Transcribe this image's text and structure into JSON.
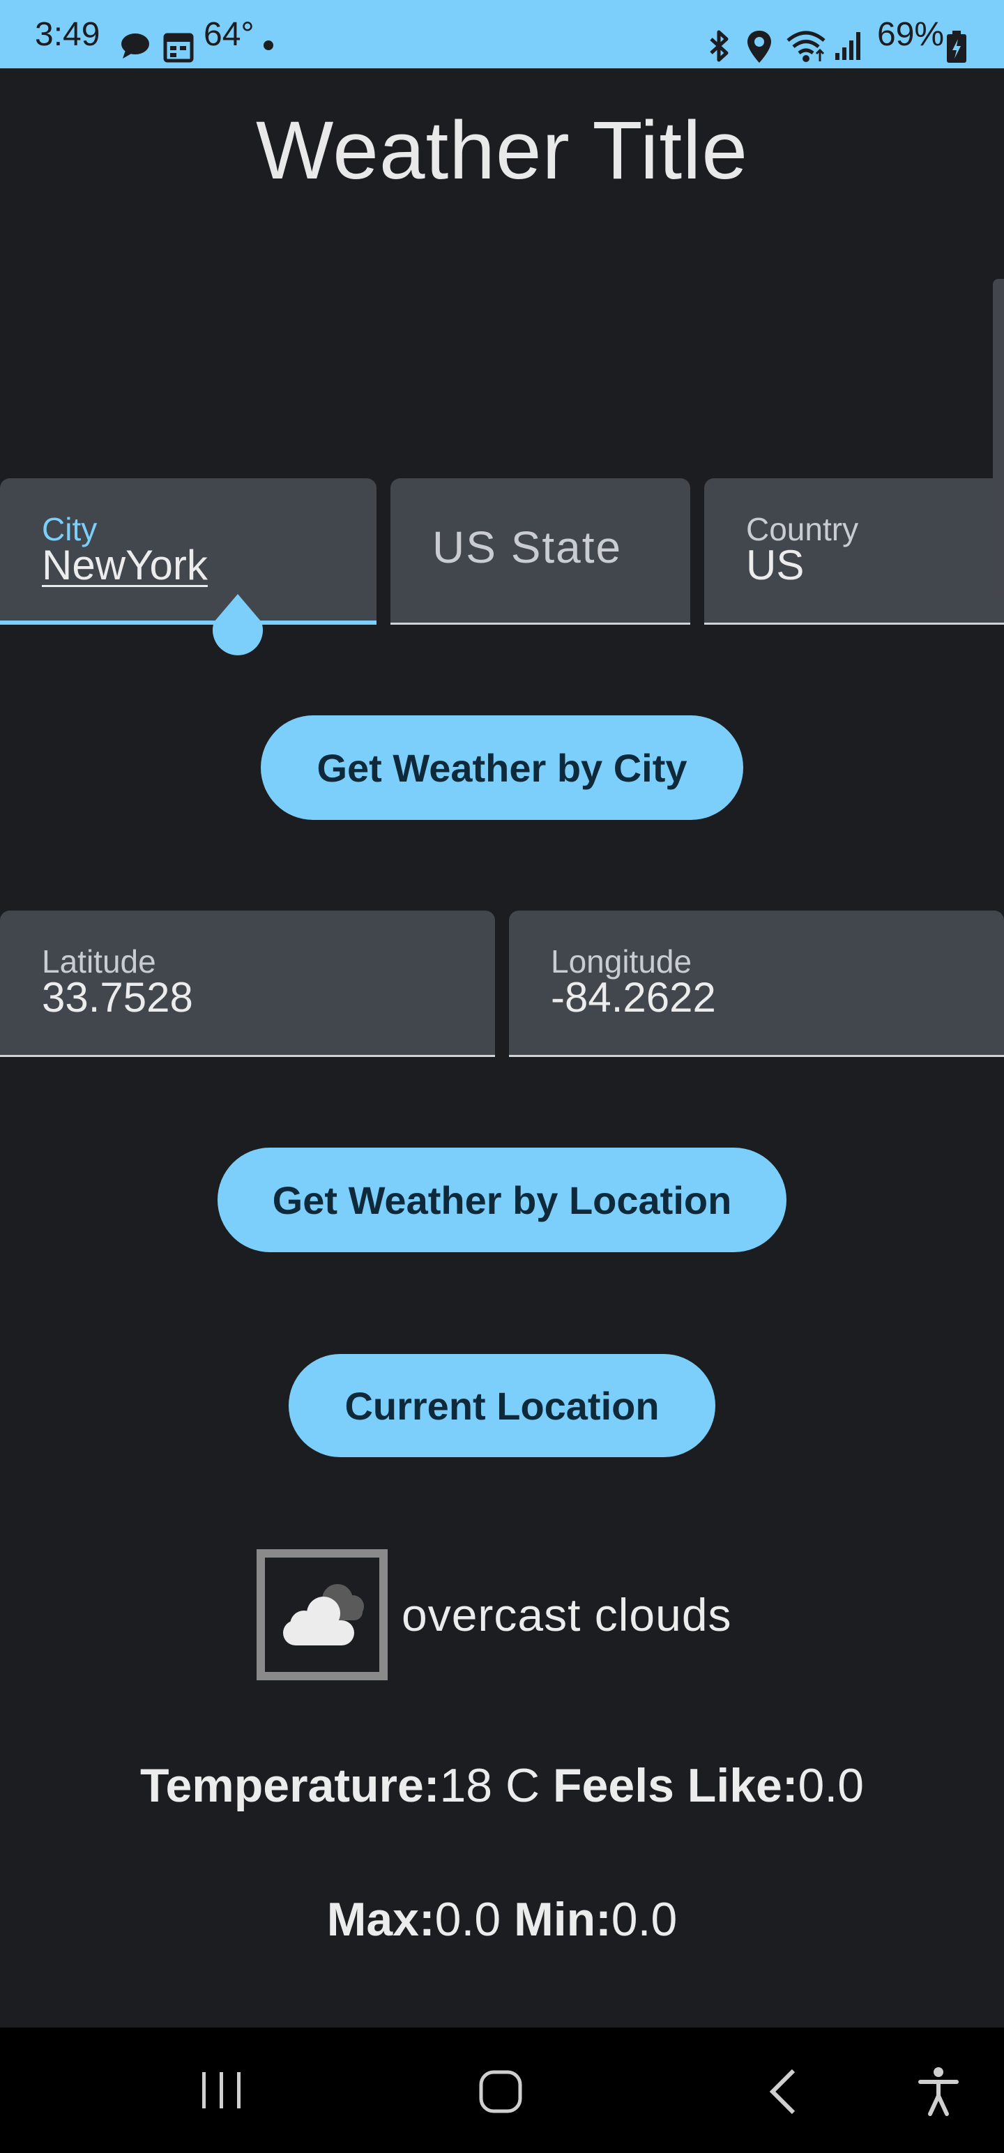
{
  "status_bar": {
    "time": "3:49",
    "temperature": "64°",
    "battery": "69%",
    "icons": [
      "chat-bubble-icon",
      "calendar-icon",
      "dot-icon",
      "bluetooth-icon",
      "location-pin-icon",
      "wifi-icon",
      "signal-icon",
      "battery-charging-icon"
    ]
  },
  "app": {
    "title": "Weather Title"
  },
  "city_form": {
    "city_label": "City",
    "city_value": "NewYork",
    "state_placeholder": "US State",
    "country_label": "Country",
    "country_value": "US",
    "button_label": "Get Weather by City"
  },
  "location_form": {
    "latitude_label": "Latitude",
    "latitude_value": "33.7528",
    "longitude_label": "Longitude",
    "longitude_value": "-84.2622",
    "button_label": "Get Weather by Location"
  },
  "current_location": {
    "button_label": "Current Location"
  },
  "weather": {
    "icon": "overcast-clouds-icon",
    "description": "overcast clouds",
    "temperature_label": "Temperature:",
    "temperature_value": "18 C",
    "feels_like_label": "Feels Like:",
    "feels_like_value": "0.0",
    "max_label": "Max:",
    "max_value": "0.0",
    "min_label": "Min:",
    "min_value": "0.0"
  },
  "colors": {
    "accent": "#7dcffb",
    "background": "#1b1d20",
    "field": "#42474e"
  },
  "nav_bar": {
    "icons": [
      "recent-apps-icon",
      "home-icon",
      "back-icon",
      "accessibility-icon"
    ]
  }
}
